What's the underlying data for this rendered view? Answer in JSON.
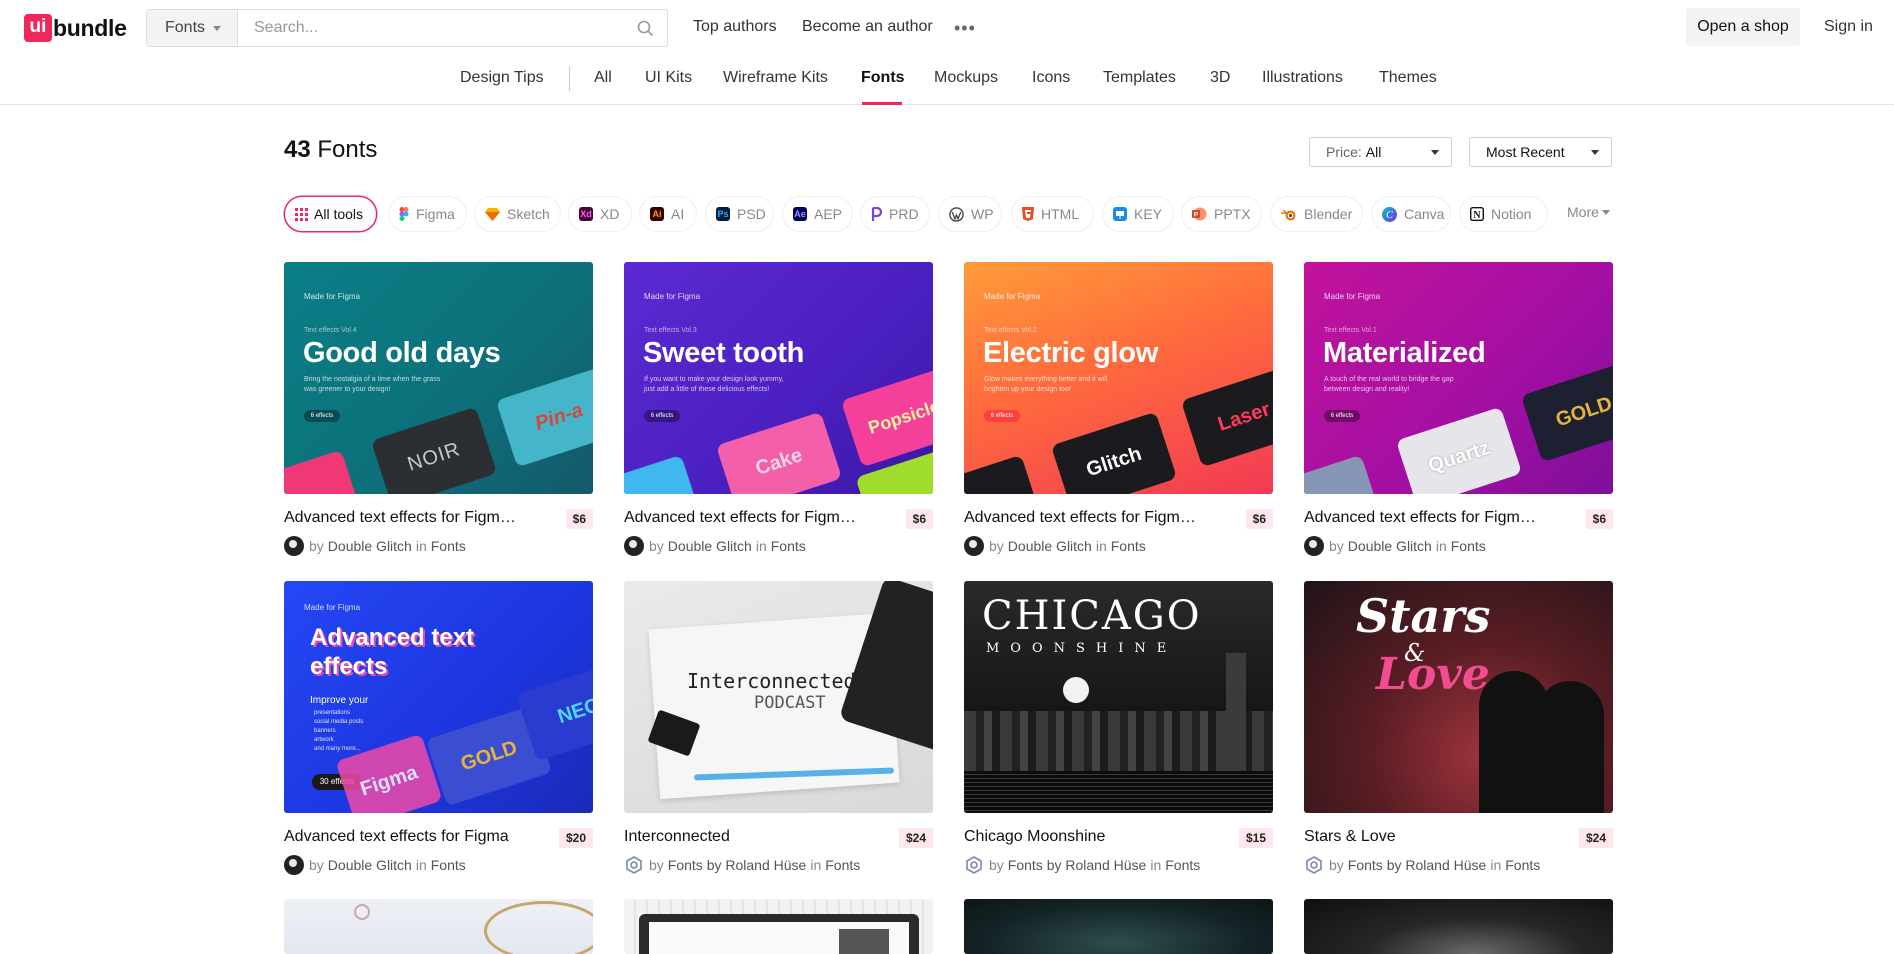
{
  "header": {
    "logo_badge": "ui",
    "logo_text": "bundle",
    "search_category": "Fonts",
    "search_placeholder": "Search...",
    "top_authors": "Top authors",
    "become_author": "Become an author",
    "more": "•••",
    "open_shop": "Open a shop",
    "sign_in": "Sign in"
  },
  "nav": {
    "items": [
      "Design Tips",
      "All",
      "UI Kits",
      "Wireframe Kits",
      "Fonts",
      "Mockups",
      "Icons",
      "Templates",
      "3D",
      "Illustrations",
      "Themes"
    ],
    "active": "Fonts"
  },
  "main": {
    "count": "43",
    "title": "Fonts",
    "price_label": "Price:",
    "price_value": "All",
    "sort": "Most Recent"
  },
  "tools": {
    "chips": [
      {
        "label": "All tools",
        "icon": "grid-icon",
        "color": "#f0275b"
      },
      {
        "label": "Figma",
        "icon": "figma-icon",
        "color": "#f24e1e"
      },
      {
        "label": "Sketch",
        "icon": "sketch-icon",
        "color": "#f7b500"
      },
      {
        "label": "XD",
        "icon": "xd-icon",
        "color": "#470137",
        "abbr": "Xd"
      },
      {
        "label": "AI",
        "icon": "ai-icon",
        "color": "#330000",
        "abbr": "Ai"
      },
      {
        "label": "PSD",
        "icon": "psd-icon",
        "color": "#001e36",
        "abbr": "Ps"
      },
      {
        "label": "AEP",
        "icon": "aep-icon",
        "color": "#00005b",
        "abbr": "Ae"
      },
      {
        "label": "PRD",
        "icon": "prd-icon",
        "color": "#7b3fe4"
      },
      {
        "label": "WP",
        "icon": "wordpress-icon",
        "color": "#464342"
      },
      {
        "label": "HTML",
        "icon": "html-icon",
        "color": "#e44d26"
      },
      {
        "label": "KEY",
        "icon": "keynote-icon",
        "color": "#1d8ce0"
      },
      {
        "label": "PPTX",
        "icon": "powerpoint-icon",
        "color": "#d24726"
      },
      {
        "label": "Blender",
        "icon": "blender-icon",
        "color": "#ea7600"
      },
      {
        "label": "Canva",
        "icon": "canva-icon",
        "color": "#00c4cc"
      },
      {
        "label": "Notion",
        "icon": "notion-icon",
        "color": "#111111"
      }
    ],
    "more": "More"
  },
  "products": [
    {
      "title": "Advanced text effects for Figma (V...",
      "price": "$6",
      "by": "by",
      "author": "Double Glitch",
      "in": "in",
      "category": "Fonts",
      "art": {
        "made": "Made for  Figma",
        "vol": "Text effects Vol.4",
        "headline": "Good old days",
        "sub": "Bring the nostalgia of a time when the grass was greener to your design!",
        "pill": "6 effects",
        "tiles": [
          "NOIR",
          "Pin-a"
        ]
      }
    },
    {
      "title": "Advanced text effects for Figma (V...",
      "price": "$6",
      "by": "by",
      "author": "Double Glitch",
      "in": "in",
      "category": "Fonts",
      "art": {
        "made": "Made for  Figma",
        "vol": "Text effects Vol.3",
        "headline": "Sweet tooth",
        "sub": "If you want to make your design look yummy, just add a little of these delicious effects!",
        "pill": "6 effects",
        "tiles": [
          "Cake",
          "Popsicle"
        ]
      }
    },
    {
      "title": "Advanced text effects for Figma (V...",
      "price": "$6",
      "by": "by",
      "author": "Double Glitch",
      "in": "in",
      "category": "Fonts",
      "art": {
        "made": "Made for  Figma",
        "vol": "Text effects Vol.2",
        "headline": "Electric glow",
        "sub": "Glow makes everything better and it will brighten up your design too!",
        "pill": "6 effects",
        "tiles": [
          "Glitch",
          "Laser"
        ]
      }
    },
    {
      "title": "Advanced text effects for Figma (V...",
      "price": "$6",
      "by": "by",
      "author": "Double Glitch",
      "in": "in",
      "category": "Fonts",
      "art": {
        "made": "Made for  Figma",
        "vol": "Text effects Vol.1",
        "headline": "Materialized",
        "sub": "A touch of the real world to bridge the gap between design and reality!",
        "pill": "6 effects",
        "tiles": [
          "Quartz",
          "GOLD"
        ]
      }
    },
    {
      "title": "Advanced text effects for Figma",
      "price": "$20",
      "by": "by",
      "author": "Double Glitch",
      "in": "in",
      "category": "Fonts",
      "art": {
        "made": "Made for  Figma",
        "headline": "Advanced text effects",
        "sub": "Improve your",
        "bullets": [
          "presentations",
          "social media posts",
          "banners",
          "artwork",
          "and many more..."
        ],
        "pill": "30 effects",
        "tiles": [
          "Figma",
          "GOLD",
          "NEO"
        ]
      }
    },
    {
      "title": "Interconnected",
      "price": "$24",
      "by": "by",
      "author": "Fonts by Roland Hüse",
      "in": "in",
      "category": "Fonts",
      "art": {
        "line1": "Interconnected",
        "line2": "PODCAST"
      }
    },
    {
      "title": "Chicago Moonshine",
      "price": "$15",
      "by": "by",
      "author": "Fonts by Roland Hüse",
      "in": "in",
      "category": "Fonts",
      "art": {
        "line1": "CHICAGO",
        "line2": "MOONSHINE"
      }
    },
    {
      "title": "Stars & Love",
      "price": "$24",
      "by": "by",
      "author": "Fonts by Roland Hüse",
      "in": "in",
      "category": "Fonts",
      "art": {
        "line1": "Stars",
        "amp": "&",
        "line2": "Love"
      }
    }
  ],
  "colors": {
    "accent": "#f0275b",
    "price_bg": "#ffe7ec"
  }
}
